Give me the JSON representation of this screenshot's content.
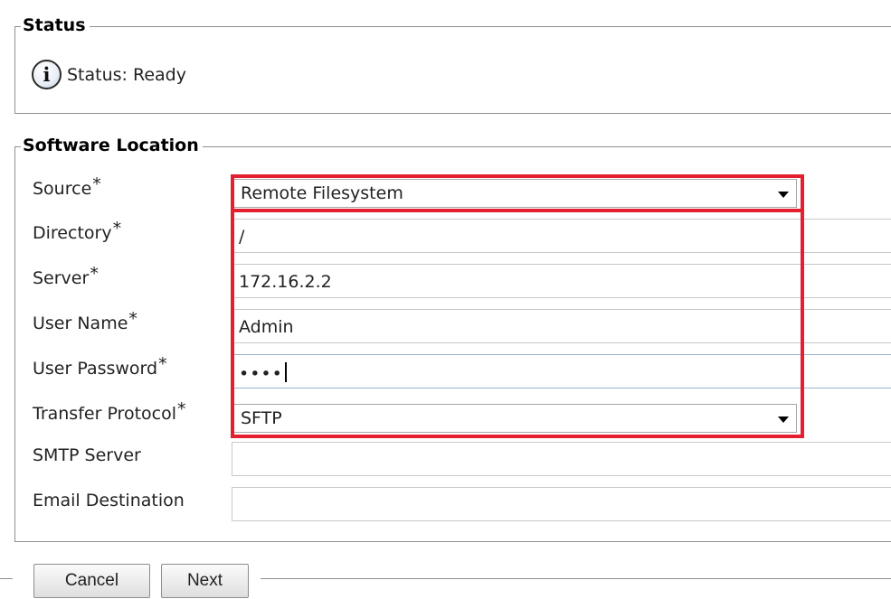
{
  "status_section": {
    "legend": "Status",
    "icon": "info-icon",
    "icon_glyph": "i",
    "text": "Status: Ready"
  },
  "software_location": {
    "legend": "Software Location",
    "required_marker": "*",
    "fields": {
      "source": {
        "label": "Source",
        "value": "Remote Filesystem",
        "required": true
      },
      "directory": {
        "label": "Directory",
        "value": "/",
        "required": true
      },
      "server": {
        "label": "Server",
        "value": "172.16.2.2",
        "required": true
      },
      "user_name": {
        "label": "User Name",
        "value": "Admin",
        "required": true
      },
      "user_password": {
        "label": "User Password",
        "value": "••••",
        "required": true
      },
      "transfer_protocol": {
        "label": "Transfer Protocol",
        "value": "SFTP",
        "required": true
      },
      "smtp_server": {
        "label": "SMTP Server",
        "value": "",
        "required": false
      },
      "email_destination": {
        "label": "Email Destination",
        "value": "",
        "required": false
      }
    }
  },
  "buttons": {
    "cancel": "Cancel",
    "next": "Next"
  },
  "colors": {
    "highlight": "#e4202e",
    "border": "#8f8f8f"
  }
}
